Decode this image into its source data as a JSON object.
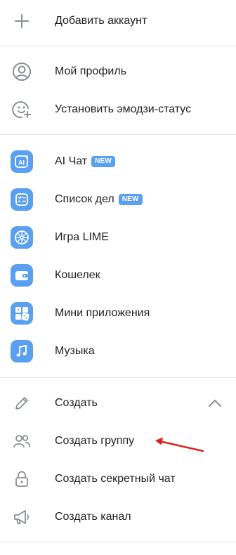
{
  "colors": {
    "accent": "#5aa0f0",
    "text": "#222222",
    "icon_gray": "#8a8f94",
    "divider": "#e6e6e6",
    "annotation_red": "#e02020"
  },
  "menu": {
    "add_account": {
      "label": "Добавить аккаунт",
      "icon": "plus-icon"
    },
    "profile": {
      "label": "Мой профиль",
      "icon": "user-circle-icon"
    },
    "emoji_status": {
      "label": "Установить эмодзи-статус",
      "icon": "smiley-plus-icon"
    },
    "apps": [
      {
        "label": "AI Чат",
        "badge": "NEW",
        "icon": "ai-icon"
      },
      {
        "label": "Список дел",
        "badge": "NEW",
        "icon": "checklist-icon"
      },
      {
        "label": "Игра LIME",
        "badge": "",
        "icon": "lime-icon"
      },
      {
        "label": "Кошелек",
        "badge": "",
        "icon": "wallet-icon"
      },
      {
        "label": "Мини приложения",
        "badge": "",
        "icon": "grid-dice-icon"
      },
      {
        "label": "Музыка",
        "badge": "",
        "icon": "music-note-icon"
      }
    ],
    "create": {
      "label": "Создать",
      "icon": "pencil-icon",
      "expanded": true
    },
    "create_items": [
      {
        "label": "Создать группу",
        "icon": "people-icon"
      },
      {
        "label": "Создать секретный чат",
        "icon": "lock-icon"
      },
      {
        "label": "Создать канал",
        "icon": "megaphone-icon"
      }
    ]
  }
}
